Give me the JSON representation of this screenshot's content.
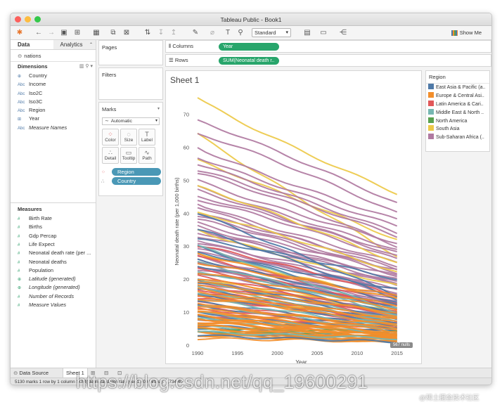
{
  "window": {
    "title": "Tableau Public - Book1"
  },
  "toolbar": {
    "fit_select": "Standard",
    "show_me": "Show Me"
  },
  "data_pane": {
    "tab_data": "Data",
    "tab_analytics": "Analytics",
    "datasource": "nations",
    "dimensions_label": "Dimensions",
    "dimensions": [
      {
        "icon": "⊕",
        "label": "Country",
        "italic": false
      },
      {
        "icon": "Abc",
        "label": "Income",
        "italic": false
      },
      {
        "icon": "Abc",
        "label": "Iso2C",
        "italic": false
      },
      {
        "icon": "Abc",
        "label": "Iso3C",
        "italic": false
      },
      {
        "icon": "Abc",
        "label": "Region",
        "italic": false
      },
      {
        "icon": "⊞",
        "label": "Year",
        "italic": false
      },
      {
        "icon": "Abc",
        "label": "Measure Names",
        "italic": true
      }
    ],
    "measures_label": "Measures",
    "measures": [
      {
        "icon": "#",
        "label": "Birth Rate",
        "italic": false
      },
      {
        "icon": "#",
        "label": "Births",
        "italic": false
      },
      {
        "icon": "#",
        "label": "Gdp Percap",
        "italic": false
      },
      {
        "icon": "#",
        "label": "Life Expect",
        "italic": false
      },
      {
        "icon": "#",
        "label": "Neonatal death rate (per ...",
        "italic": false
      },
      {
        "icon": "#",
        "label": "Neonatal deaths",
        "italic": false
      },
      {
        "icon": "#",
        "label": "Population",
        "italic": false
      },
      {
        "icon": "⊕",
        "label": "Latitude (generated)",
        "italic": true
      },
      {
        "icon": "⊕",
        "label": "Longitude (generated)",
        "italic": true
      },
      {
        "icon": "#",
        "label": "Number of Records",
        "italic": true
      },
      {
        "icon": "#",
        "label": "Measure Values",
        "italic": true
      }
    ]
  },
  "cards": {
    "pages": "Pages",
    "filters": "Filters",
    "marks": "Marks",
    "mark_type": "Automatic",
    "buttons": [
      {
        "label": "Color",
        "glyph": "⁘"
      },
      {
        "label": "Size",
        "glyph": "◌"
      },
      {
        "label": "Label",
        "glyph": "T"
      },
      {
        "label": "Detail",
        "glyph": "∴"
      },
      {
        "label": "Tooltip",
        "glyph": "▭"
      },
      {
        "label": "Path",
        "glyph": "∿"
      }
    ],
    "pill_region": "Region",
    "pill_country": "Country"
  },
  "shelves": {
    "columns_label": "Columns",
    "columns_pill": "Year",
    "rows_label": "Rows",
    "rows_pill": "SUM(Neonatal death r.."
  },
  "sheet": {
    "title": "Sheet 1",
    "nulls": "567 nulls"
  },
  "legend": {
    "title": "Region",
    "items": [
      {
        "label": "East Asia & Pacific (a..",
        "color": "#4e79a7"
      },
      {
        "label": "Europe & Central Asi..",
        "color": "#f28e2b"
      },
      {
        "label": "Latin America & Cari..",
        "color": "#e15759"
      },
      {
        "label": "Middle East & North ..",
        "color": "#76b7b2"
      },
      {
        "label": "North America",
        "color": "#59a14f"
      },
      {
        "label": "South Asia",
        "color": "#edc948"
      },
      {
        "label": "Sub-Saharan Africa (..",
        "color": "#b07aa1"
      }
    ]
  },
  "chart_data": {
    "type": "line",
    "xlabel": "Year",
    "ylabel": "Neonatal death rate (per 1,000 births)",
    "xticks": [
      1990,
      1995,
      2000,
      2005,
      2010,
      2015
    ],
    "yticks": [
      0,
      10,
      20,
      30,
      40,
      50,
      60,
      70
    ],
    "xlim": [
      1990,
      2016
    ],
    "ylim": [
      0,
      75
    ],
    "series": [
      {
        "color": "#edc948",
        "start": 75,
        "end": 46
      },
      {
        "color": "#edc948",
        "start": 64,
        "end": 27
      },
      {
        "color": "#edc948",
        "start": 56,
        "end": 32
      },
      {
        "color": "#b07aa1",
        "start": 68,
        "end": 43
      },
      {
        "color": "#b07aa1",
        "start": 64,
        "end": 40
      },
      {
        "color": "#b07aa1",
        "start": 60,
        "end": 38
      },
      {
        "color": "#b07aa1",
        "start": 57,
        "end": 36
      },
      {
        "color": "#b07aa1",
        "start": 55,
        "end": 34
      },
      {
        "color": "#b07aa1",
        "start": 53,
        "end": 33
      },
      {
        "color": "#b07aa1",
        "start": 52,
        "end": 30
      },
      {
        "color": "#b07aa1",
        "start": 50,
        "end": 31
      },
      {
        "color": "#b07aa1",
        "start": 48,
        "end": 29
      },
      {
        "color": "#b07aa1",
        "start": 47,
        "end": 27
      },
      {
        "color": "#b07aa1",
        "start": 45,
        "end": 28
      },
      {
        "color": "#b07aa1",
        "start": 44,
        "end": 26
      },
      {
        "color": "#b07aa1",
        "start": 43,
        "end": 25
      },
      {
        "color": "#b07aa1",
        "start": 42,
        "end": 23
      },
      {
        "color": "#b07aa1",
        "start": 40,
        "end": 24
      },
      {
        "color": "#b07aa1",
        "start": 39,
        "end": 22
      },
      {
        "color": "#b07aa1",
        "start": 38,
        "end": 21
      },
      {
        "color": "#b07aa1",
        "start": 37,
        "end": 23
      },
      {
        "color": "#b07aa1",
        "start": 36,
        "end": 20
      },
      {
        "color": "#b07aa1",
        "start": 35,
        "end": 19
      },
      {
        "color": "#b07aa1",
        "start": 34,
        "end": 21
      },
      {
        "color": "#b07aa1",
        "start": 33,
        "end": 18
      },
      {
        "color": "#b07aa1",
        "start": 32,
        "end": 17
      },
      {
        "color": "#b07aa1",
        "start": 31,
        "end": 19
      },
      {
        "color": "#b07aa1",
        "start": 30,
        "end": 16
      },
      {
        "color": "#b07aa1",
        "start": 29,
        "end": 15
      },
      {
        "color": "#b07aa1",
        "start": 28,
        "end": 17
      },
      {
        "color": "#b07aa1",
        "start": 27,
        "end": 14
      },
      {
        "color": "#b07aa1",
        "start": 26,
        "end": 13
      },
      {
        "color": "#b07aa1",
        "start": 25,
        "end": 15
      },
      {
        "color": "#b07aa1",
        "start": 24,
        "end": 12
      },
      {
        "color": "#b07aa1",
        "start": 23,
        "end": 11
      },
      {
        "color": "#b07aa1",
        "start": 22,
        "end": 13
      },
      {
        "color": "#b07aa1",
        "start": 20,
        "end": 10
      },
      {
        "color": "#b07aa1",
        "start": 18,
        "end": 9
      },
      {
        "color": "#edc948",
        "start": 48,
        "end": 25
      },
      {
        "color": "#edc948",
        "start": 40,
        "end": 22
      },
      {
        "color": "#edc948",
        "start": 35,
        "end": 18
      },
      {
        "color": "#edc948",
        "start": 28,
        "end": 14
      },
      {
        "color": "#edc948",
        "start": 20,
        "end": 10
      },
      {
        "color": "#edc948",
        "start": 16,
        "end": 6
      },
      {
        "color": "#e15759",
        "start": 30,
        "end": 15
      },
      {
        "color": "#e15759",
        "start": 27,
        "end": 13
      },
      {
        "color": "#e15759",
        "start": 25,
        "end": 11
      },
      {
        "color": "#e15759",
        "start": 23,
        "end": 12
      },
      {
        "color": "#e15759",
        "start": 21,
        "end": 9
      },
      {
        "color": "#e15759",
        "start": 19,
        "end": 8
      },
      {
        "color": "#e15759",
        "start": 18,
        "end": 10
      },
      {
        "color": "#e15759",
        "start": 17,
        "end": 7
      },
      {
        "color": "#e15759",
        "start": 16,
        "end": 8
      },
      {
        "color": "#e15759",
        "start": 15,
        "end": 6
      },
      {
        "color": "#e15759",
        "start": 14,
        "end": 7
      },
      {
        "color": "#e15759",
        "start": 13,
        "end": 6
      },
      {
        "color": "#e15759",
        "start": 12,
        "end": 5
      },
      {
        "color": "#e15759",
        "start": 11,
        "end": 5
      },
      {
        "color": "#e15759",
        "start": 10,
        "end": 4
      },
      {
        "color": "#e15759",
        "start": 9,
        "end": 5
      },
      {
        "color": "#e15759",
        "start": 8,
        "end": 4
      },
      {
        "color": "#e15759",
        "start": 7,
        "end": 3
      },
      {
        "color": "#4e79a7",
        "start": 40,
        "end": 15
      },
      {
        "color": "#4e79a7",
        "start": 35,
        "end": 14
      },
      {
        "color": "#4e79a7",
        "start": 32,
        "end": 20
      },
      {
        "color": "#4e79a7",
        "start": 30,
        "end": 13
      },
      {
        "color": "#4e79a7",
        "start": 28,
        "end": 17
      },
      {
        "color": "#4e79a7",
        "start": 26,
        "end": 12
      },
      {
        "color": "#4e79a7",
        "start": 24,
        "end": 11
      },
      {
        "color": "#4e79a7",
        "start": 22,
        "end": 9
      },
      {
        "color": "#4e79a7",
        "start": 20,
        "end": 8
      },
      {
        "color": "#4e79a7",
        "start": 19,
        "end": 10
      },
      {
        "color": "#4e79a7",
        "start": 17,
        "end": 7
      },
      {
        "color": "#4e79a7",
        "start": 15,
        "end": 6
      },
      {
        "color": "#4e79a7",
        "start": 13,
        "end": 5
      },
      {
        "color": "#4e79a7",
        "start": 12,
        "end": 5
      },
      {
        "color": "#4e79a7",
        "start": 10,
        "end": 4
      },
      {
        "color": "#4e79a7",
        "start": 9,
        "end": 3
      },
      {
        "color": "#4e79a7",
        "start": 8,
        "end": 4
      },
      {
        "color": "#4e79a7",
        "start": 6,
        "end": 2
      },
      {
        "color": "#4e79a7",
        "start": 5,
        "end": 2
      },
      {
        "color": "#4e79a7",
        "start": 4,
        "end": 1
      },
      {
        "color": "#76b7b2",
        "start": 30,
        "end": 10
      },
      {
        "color": "#76b7b2",
        "start": 25,
        "end": 9
      },
      {
        "color": "#76b7b2",
        "start": 22,
        "end": 11
      },
      {
        "color": "#76b7b2",
        "start": 20,
        "end": 8
      },
      {
        "color": "#76b7b2",
        "start": 18,
        "end": 7
      },
      {
        "color": "#76b7b2",
        "start": 16,
        "end": 6
      },
      {
        "color": "#76b7b2",
        "start": 14,
        "end": 5
      },
      {
        "color": "#76b7b2",
        "start": 12,
        "end": 4
      },
      {
        "color": "#76b7b2",
        "start": 10,
        "end": 3
      },
      {
        "color": "#76b7b2",
        "start": 8,
        "end": 3
      },
      {
        "color": "#76b7b2",
        "start": 6,
        "end": 2
      },
      {
        "color": "#59a14f",
        "start": 5,
        "end": 4
      },
      {
        "color": "#59a14f",
        "start": 4,
        "end": 3
      },
      {
        "color": "#f28e2b",
        "start": 28,
        "end": 14
      },
      {
        "color": "#f28e2b",
        "start": 25,
        "end": 15
      },
      {
        "color": "#f28e2b",
        "start": 22,
        "end": 12
      },
      {
        "color": "#f28e2b",
        "start": 20,
        "end": 11
      },
      {
        "color": "#f28e2b",
        "start": 19,
        "end": 9
      },
      {
        "color": "#f28e2b",
        "start": 18,
        "end": 10
      },
      {
        "color": "#f28e2b",
        "start": 17,
        "end": 8
      },
      {
        "color": "#f28e2b",
        "start": 16,
        "end": 7
      },
      {
        "color": "#f28e2b",
        "start": 15,
        "end": 6
      },
      {
        "color": "#f28e2b",
        "start": 14,
        "end": 8
      },
      {
        "color": "#f28e2b",
        "start": 13,
        "end": 5
      },
      {
        "color": "#f28e2b",
        "start": 12,
        "end": 6
      },
      {
        "color": "#f28e2b",
        "start": 11,
        "end": 4
      },
      {
        "color": "#f28e2b",
        "start": 10,
        "end": 5
      },
      {
        "color": "#f28e2b",
        "start": 10,
        "end": 3
      },
      {
        "color": "#f28e2b",
        "start": 9,
        "end": 4
      },
      {
        "color": "#f28e2b",
        "start": 9,
        "end": 3
      },
      {
        "color": "#f28e2b",
        "start": 8,
        "end": 2
      },
      {
        "color": "#f28e2b",
        "start": 8,
        "end": 3
      },
      {
        "color": "#f28e2b",
        "start": 7,
        "end": 2
      },
      {
        "color": "#f28e2b",
        "start": 7,
        "end": 3
      },
      {
        "color": "#f28e2b",
        "start": 6,
        "end": 2
      },
      {
        "color": "#f28e2b",
        "start": 6,
        "end": 3
      },
      {
        "color": "#f28e2b",
        "start": 5,
        "end": 2
      },
      {
        "color": "#f28e2b",
        "start": 5,
        "end": 1
      },
      {
        "color": "#f28e2b",
        "start": 4,
        "end": 2
      },
      {
        "color": "#f28e2b",
        "start": 4,
        "end": 1
      },
      {
        "color": "#f28e2b",
        "start": 3,
        "end": 1
      },
      {
        "color": "#f28e2b",
        "start": 3,
        "end": 2
      },
      {
        "color": "#f28e2b",
        "start": 2,
        "end": 1
      },
      {
        "color": "#4e79a7",
        "start": 3,
        "end": 1
      },
      {
        "color": "#76b7b2",
        "start": 4,
        "end": 2
      }
    ]
  },
  "bottom": {
    "datasource_tab": "Data Source",
    "sheet_tab": "Sheet 1",
    "status": "5130 marks    1 row by 1 column    SUM(Neonatal death rate (per 1,000 births)): 7,734.40"
  },
  "watermark": {
    "url": "https://blog.csdn.net/qq_19600291",
    "cn": "@稀土掘金技术社区"
  }
}
